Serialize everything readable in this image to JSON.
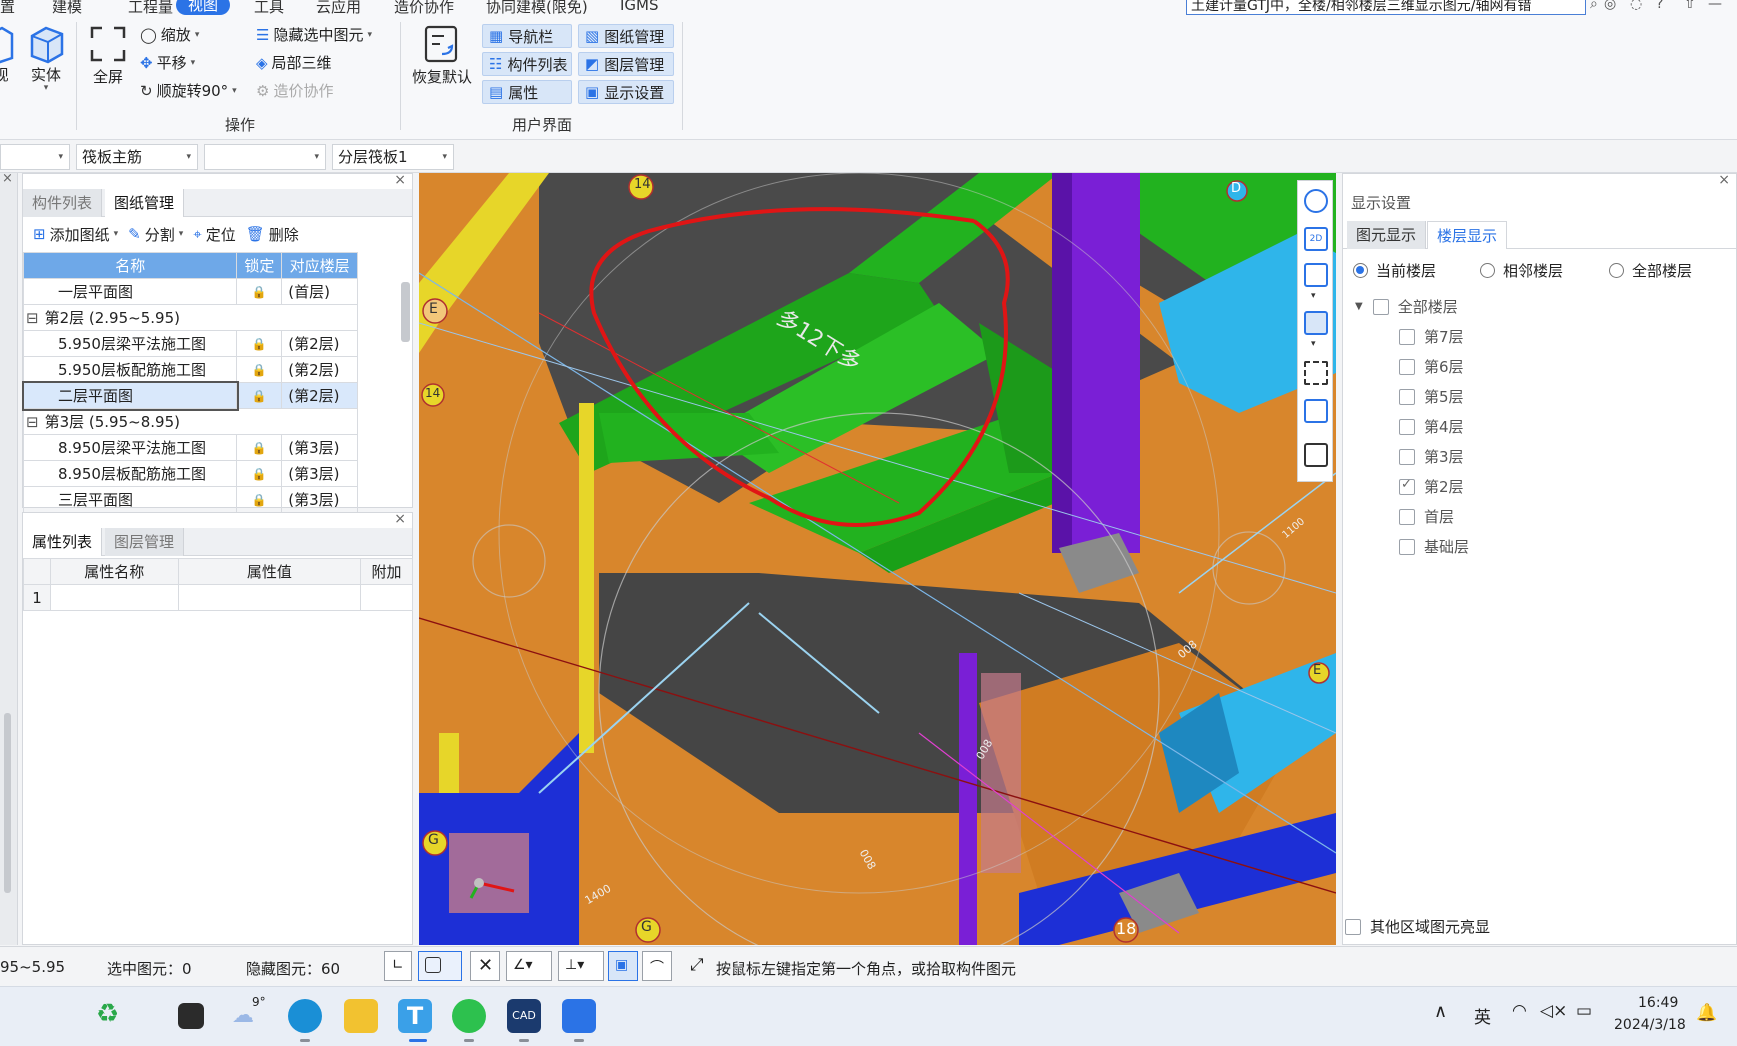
{
  "menu": {
    "tabs": [
      "置",
      "建模",
      "工程量",
      "视图",
      "工具",
      "云应用",
      "造价协作",
      "协同建模(限免)",
      "IGMS"
    ],
    "active_tab": "视图",
    "search_text": "土建计量GTJ中，全楼/相邻楼层三维显示图元/轴网有错"
  },
  "ribbon": {
    "view_left": "视",
    "solid": "实体",
    "fullscreen": "全屏",
    "zoom": "缩放",
    "pan": "平移",
    "rotate": "顺旋转90°",
    "hide_selected": "隐藏选中图元",
    "local_3d": "局部三维",
    "cost_collab": "造价协作",
    "ops_group": "操作",
    "restore_default": "恢复默认",
    "navbar": "导航栏",
    "component_list": "构件列表",
    "properties": "属性",
    "drawing_mgmt": "图纸管理",
    "layer_mgmt": "图层管理",
    "display_settings": "显示设置",
    "ui_group": "用户界面"
  },
  "dropdowns": [
    "",
    "筏板主筋",
    "",
    "分层筏板1"
  ],
  "drawing_panel": {
    "tabs": [
      "构件列表",
      "图纸管理"
    ],
    "active_tab": "图纸管理",
    "tools": [
      "添加图纸",
      "分割",
      "定位",
      "删除"
    ],
    "columns": [
      "名称",
      "锁定",
      "对应楼层"
    ],
    "rows": [
      {
        "name": "一层平面图",
        "floor": "(首层)",
        "group": false,
        "indent": 1
      },
      {
        "name": "第2层 (2.95~5.95)",
        "floor": "",
        "group": true,
        "indent": 0
      },
      {
        "name": "5.950层梁平法施工图",
        "floor": "(第2层)",
        "group": false,
        "indent": 1
      },
      {
        "name": "5.950层板配筋施工图",
        "floor": "(第2层)",
        "group": false,
        "indent": 1
      },
      {
        "name": "二层平面图",
        "floor": "(第2层)",
        "group": false,
        "indent": 1,
        "selected": true
      },
      {
        "name": "第3层 (5.95~8.95)",
        "floor": "",
        "group": true,
        "indent": 0
      },
      {
        "name": "8.950层梁平法施工图",
        "floor": "(第3层)",
        "group": false,
        "indent": 1
      },
      {
        "name": "8.950层板配筋施工图",
        "floor": "(第3层)",
        "group": false,
        "indent": 1
      },
      {
        "name": "三层平面图",
        "floor": "(第3层)",
        "group": false,
        "indent": 1
      }
    ]
  },
  "property_panel": {
    "tabs": [
      "属性列表",
      "图层管理"
    ],
    "active_tab": "属性列表",
    "columns": [
      "属性名称",
      "属性值",
      "附加"
    ],
    "row_number": "1"
  },
  "viewport": {
    "axis_labels": [
      "E",
      "14",
      "14",
      "G",
      "G",
      "18",
      "D",
      "E"
    ],
    "slab_text": "多12下多",
    "dim_labels": [
      "1100",
      "008",
      "008",
      "008",
      "1400"
    ]
  },
  "display_settings": {
    "title": "显示设置",
    "tabs": [
      "图元显示",
      "楼层显示"
    ],
    "active_tab": "楼层显示",
    "radios": [
      "当前楼层",
      "相邻楼层",
      "全部楼层"
    ],
    "selected_radio": "当前楼层",
    "all_floors": "全部楼层",
    "floors": [
      {
        "name": "第7层",
        "checked": false
      },
      {
        "name": "第6层",
        "checked": false
      },
      {
        "name": "第5层",
        "checked": false
      },
      {
        "name": "第4层",
        "checked": false
      },
      {
        "name": "第3层",
        "checked": false
      },
      {
        "name": "第2层",
        "checked": true
      },
      {
        "name": "首层",
        "checked": false
      },
      {
        "name": "基础层",
        "checked": false
      }
    ],
    "other_area": "其他区域图元亮显"
  },
  "status": {
    "elevation": "95~5.95",
    "selected": "选中图元：0",
    "hidden": "隐藏图元：60",
    "hint": "按鼠标左键指定第一个角点，或拾取构件图元"
  },
  "taskbar": {
    "weather": "9°",
    "ime": "英",
    "time": "16:49",
    "date": "2024/3/18"
  },
  "colors": {
    "accent": "#2b73e6",
    "slab_gray": "#4a4a4a",
    "beam_green": "#22b21f",
    "column_purple": "#7a1fd6",
    "wall_orange": "#d8862c",
    "annotation_red": "#e01515"
  }
}
